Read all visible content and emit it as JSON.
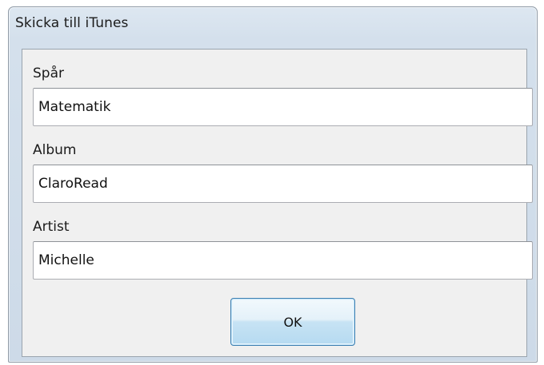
{
  "dialog": {
    "title": "Skicka till iTunes",
    "fields": [
      {
        "label": "Spår",
        "value": "Matematik"
      },
      {
        "label": "Album",
        "value": "ClaroRead"
      },
      {
        "label": "Artist",
        "value": "Michelle"
      }
    ],
    "ok_label": "OK"
  }
}
